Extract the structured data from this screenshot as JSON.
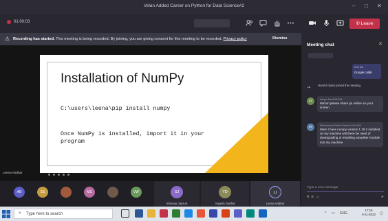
{
  "window": {
    "title": "Velan Added Career on Python for Data Science#2",
    "controls": [
      "–",
      "□",
      "✕"
    ]
  },
  "toolbar": {
    "timer": "01:00:03",
    "leave_label": "Leave",
    "icons": [
      "participants-icon",
      "chat-icon",
      "raise-hand-icon",
      "more-icon",
      "camera-icon",
      "mic-icon",
      "share-icon"
    ]
  },
  "banner": {
    "warn_glyph": "⚠",
    "strong": "Recording has started.",
    "text": "This meeting is being recorded. By joining, you are giving consent for this meeting to be recorded.",
    "link": "Privacy policy",
    "dismiss": "Dismiss"
  },
  "slide": {
    "title": "Installation of NumPy",
    "command": "C:\\users\\leena\\pip install numpy",
    "note": "Once NumPy is installed, import it in your program",
    "accent": "#f3b51c"
  },
  "stage": {
    "presenter": "Leena Aadhar"
  },
  "participants": {
    "avatars": [
      {
        "initials": "AB",
        "color": "#5b5fc7"
      },
      {
        "initials": "SS",
        "color": "#c29c3e"
      },
      {
        "initials": "",
        "color": "#a15a3c"
      },
      {
        "initials": "MS",
        "color": "#b56aa0"
      },
      {
        "initials": "",
        "color": "#6f5a4a"
      },
      {
        "initials": "VW",
        "color": "#6a9a5c"
      }
    ],
    "tiles": [
      {
        "initials": "SJ",
        "name": "Shreyas Jaysurt",
        "color": "#8c6ac8"
      },
      {
        "initials": "YD",
        "name": "Yogesh Dutthal",
        "color": "#8a8a5a"
      },
      {
        "initials": "LI",
        "name": "Leena Aadhar",
        "color": "#3a3a44"
      }
    ]
  },
  "chat": {
    "title": "Meeting chat",
    "close": "✕",
    "my_message": {
      "time": "8:51 AM",
      "text": "Google colab"
    },
    "system": "Harshit Saini joined the meeting.",
    "messages": [
      {
        "initials": "AS",
        "meta": "Aarya Jha   8:53 AM",
        "body": "Ma'am please share ipi online on your screen",
        "color": "#6b8e4e"
      },
      {
        "initials": "MS",
        "meta": "Mohammed Zahid Hashmi   9:04 AM",
        "body": "Mam I have numpy version 1.19.2 installed on my machine will there be need of downgrading or installing anywther module into my machine",
        "color": "#5a7ea8"
      }
    ],
    "compose_placeholder": "Type a new message"
  },
  "taskbar": {
    "search_placeholder": "Type here to search",
    "clock_time": "17:18",
    "clock_date": "9-11-2023",
    "lang": "ENG"
  }
}
